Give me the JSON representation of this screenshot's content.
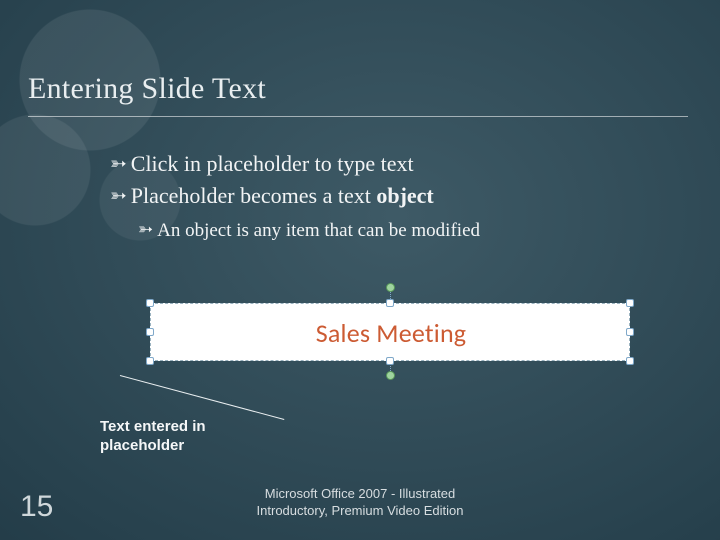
{
  "title": "Entering Slide Text",
  "bullets": {
    "b1": "Click in placeholder to type text",
    "b2_a": "Placeholder becomes a text ",
    "b2_b": "object",
    "sub1": "An object is any item that can be modified"
  },
  "illustration": {
    "placeholder_text": "Sales Meeting"
  },
  "callout": {
    "label": "Text entered in placeholder"
  },
  "footer": {
    "line1": "Microsoft Office 2007 - Illustrated",
    "line2": "Introductory, Premium Video Edition"
  },
  "slide_number": "15",
  "glyphs": {
    "bullet": "➳"
  }
}
